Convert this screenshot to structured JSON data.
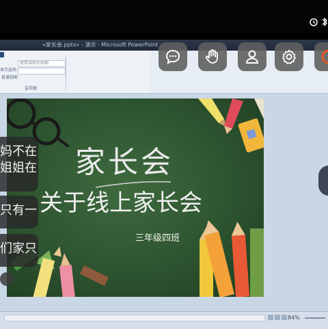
{
  "status_bar": {
    "icons": [
      "alarm-icon",
      "bluetooth-icon"
    ]
  },
  "window": {
    "title": "«家长会.pptx» - 演示 - Microsoft PowerPoint"
  },
  "ribbon": {
    "field1_placeholder": "使用当前的视图",
    "field2_label": "显示选项",
    "view_label": "普通视图",
    "group_label": "监视器"
  },
  "slide": {
    "title": "家长会",
    "subtitle": "关于线上家长会",
    "class_label": "三年级四班"
  },
  "chat_messages": [
    {
      "line1": "妈不在",
      "line2": "姐姐在"
    },
    {
      "line1": "只有一"
    },
    {
      "line1": "们家只"
    }
  ],
  "meeting_controls": [
    {
      "icon": "chat-icon"
    },
    {
      "icon": "raise-hand-icon"
    },
    {
      "icon": "participants-icon"
    },
    {
      "icon": "settings-icon"
    },
    {
      "icon": "record-icon"
    }
  ],
  "editor_status": {
    "zoom": "84%"
  },
  "colors": {
    "chalkboard": "#2d5430",
    "titlebar": "#20293a",
    "accent_record": "#e5572a"
  }
}
